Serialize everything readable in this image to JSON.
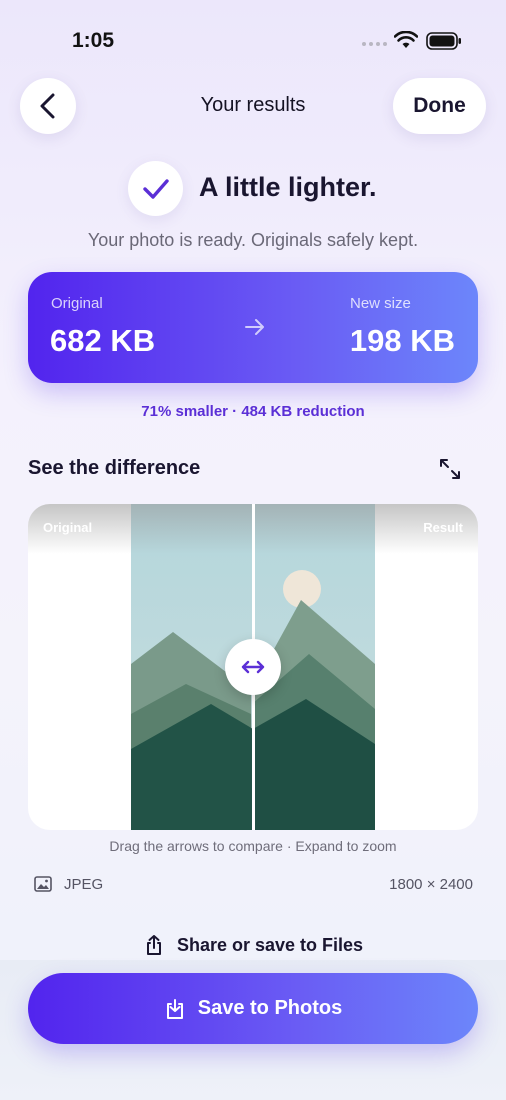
{
  "status_bar": {
    "time": "1:05"
  },
  "header": {
    "title": "Your results",
    "done_label": "Done"
  },
  "result": {
    "headline": "A little lighter.",
    "subline": "Your photo is ready. Originals safely kept."
  },
  "size_card": {
    "original_label": "Original",
    "original_value": "682 KB",
    "new_label": "New size",
    "new_value": "198 KB"
  },
  "reduction_text": "71% smaller · 484 KB reduction",
  "compare": {
    "section_title": "See the difference",
    "left_label": "Original",
    "right_label": "Result",
    "hint": "Drag the arrows to compare · Expand to zoom"
  },
  "file_info": {
    "format": "JPEG",
    "dimensions": "1800 × 2400"
  },
  "actions": {
    "share_label": "Share or save to Files",
    "save_label": "Save to Photos"
  },
  "colors": {
    "accent": "#5224ee",
    "accent_end": "#6c86fb",
    "check": "#5b2fd6"
  },
  "icons": [
    "back-chevron-icon",
    "checkmark-icon",
    "arrow-right-icon",
    "expand-icon",
    "compare-handle-icon",
    "image-icon",
    "share-icon",
    "save-download-icon",
    "wifi-icon",
    "battery-icon"
  ]
}
